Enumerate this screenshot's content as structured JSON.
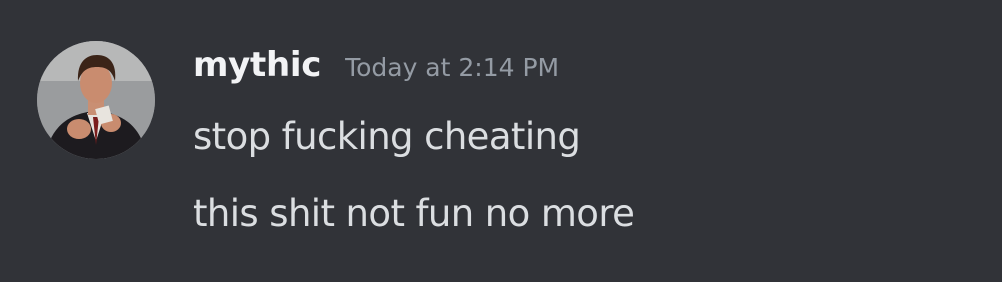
{
  "message": {
    "author": {
      "username": "mythic",
      "avatar_icon": "user-avatar-icon"
    },
    "timestamp": "Today at 2:14 PM",
    "lines": [
      "stop fucking cheating",
      "this shit not fun no more"
    ]
  },
  "colors": {
    "background": "#313338",
    "username": "#f2f3f5",
    "timestamp": "#949ba4",
    "message_text": "#dbdee1"
  }
}
